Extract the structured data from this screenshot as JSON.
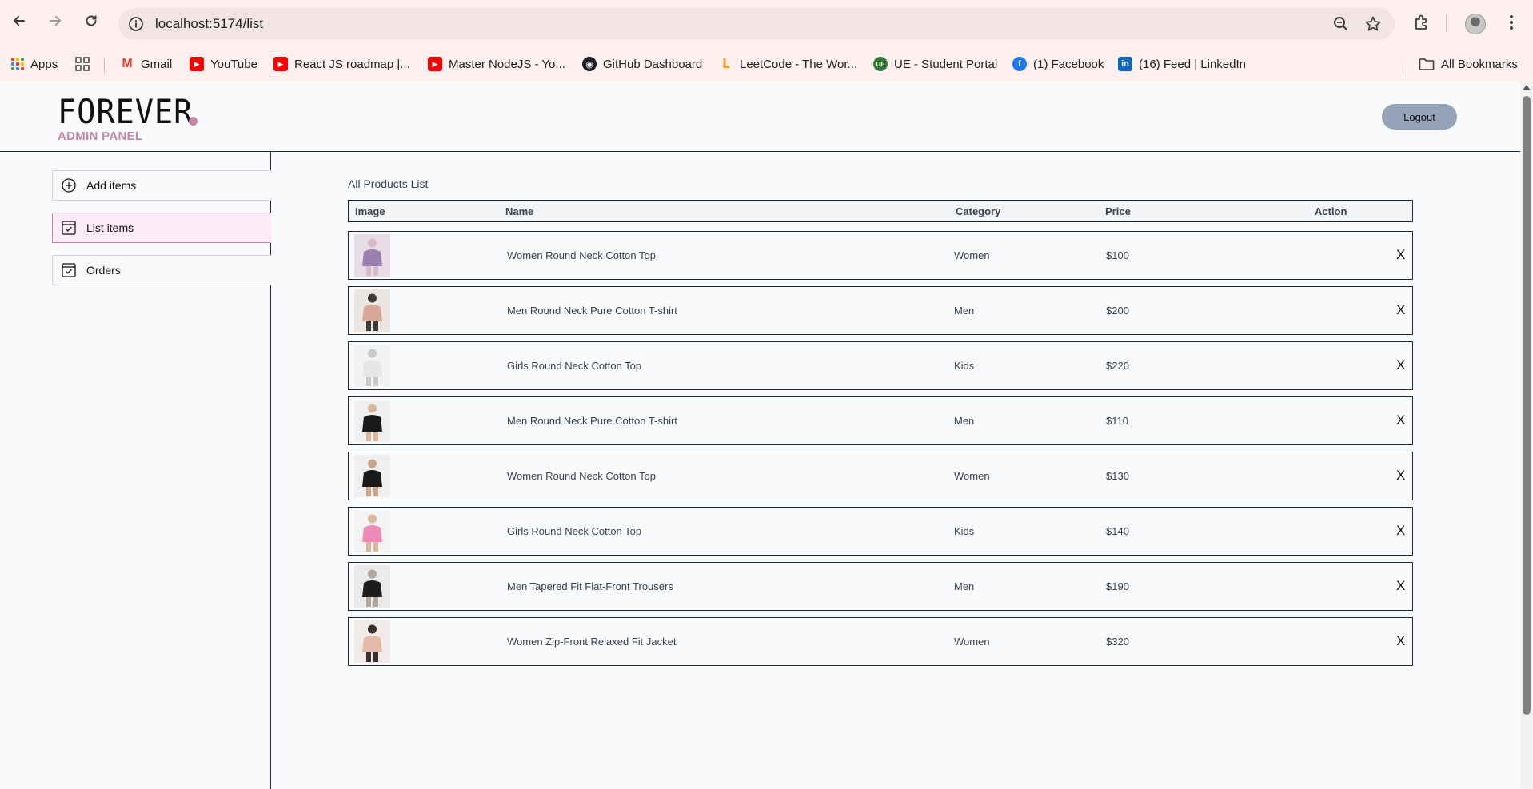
{
  "browser": {
    "url": "localhost:5174/list",
    "bookmarks": [
      {
        "label": "Apps",
        "icon": "apps-grid-icon"
      },
      {
        "label": "Gmail",
        "icon": "gmail-icon"
      },
      {
        "label": "YouTube",
        "icon": "youtube-icon"
      },
      {
        "label": "React JS roadmap |...",
        "icon": "youtube-icon"
      },
      {
        "label": "Master NodeJS - Yo...",
        "icon": "youtube-icon"
      },
      {
        "label": "GitHub Dashboard",
        "icon": "github-icon"
      },
      {
        "label": "LeetCode - The Wor...",
        "icon": "leetcode-icon"
      },
      {
        "label": "UE - Student Portal",
        "icon": "ue-portal-icon"
      },
      {
        "label": "(1) Facebook",
        "icon": "facebook-icon"
      },
      {
        "label": "(16) Feed | LinkedIn",
        "icon": "linkedin-icon"
      }
    ],
    "all_bookmarks": "All Bookmarks"
  },
  "header": {
    "logo_word": "FOREVER",
    "logo_sub": "ADMIN PANEL",
    "logout_label": "Logout"
  },
  "sidebar": {
    "items": [
      {
        "label": "Add items",
        "icon": "add-circle-icon",
        "active": false
      },
      {
        "label": "List items",
        "icon": "checklist-icon",
        "active": true
      },
      {
        "label": "Orders",
        "icon": "checklist-icon",
        "active": false
      }
    ]
  },
  "main": {
    "title": "All Products List",
    "columns": [
      "Image",
      "Name",
      "Category",
      "Price",
      "Action"
    ],
    "rows": [
      {
        "name": "Women Round Neck Cotton Top",
        "category": "Women",
        "price": "$100",
        "action": "X"
      },
      {
        "name": "Men Round Neck Pure Cotton T-shirt",
        "category": "Men",
        "price": "$200",
        "action": "X"
      },
      {
        "name": "Girls Round Neck Cotton Top",
        "category": "Kids",
        "price": "$220",
        "action": "X"
      },
      {
        "name": "Men Round Neck Pure Cotton T-shirt",
        "category": "Men",
        "price": "$110",
        "action": "X"
      },
      {
        "name": "Women Round Neck Cotton Top",
        "category": "Women",
        "price": "$130",
        "action": "X"
      },
      {
        "name": "Girls Round Neck Cotton Top",
        "category": "Kids",
        "price": "$140",
        "action": "X"
      },
      {
        "name": "Men Tapered Fit Flat-Front Trousers",
        "category": "Men",
        "price": "$190",
        "action": "X"
      },
      {
        "name": "Women Zip-Front Relaxed Fit Jacket",
        "category": "Women",
        "price": "$320",
        "action": "X"
      }
    ]
  },
  "colors": {
    "accent_pink": "#c586a5",
    "active_bg": "#ffebf5",
    "logout_bg": "#94a3b8",
    "chrome_bg": "#fdf0ee"
  }
}
